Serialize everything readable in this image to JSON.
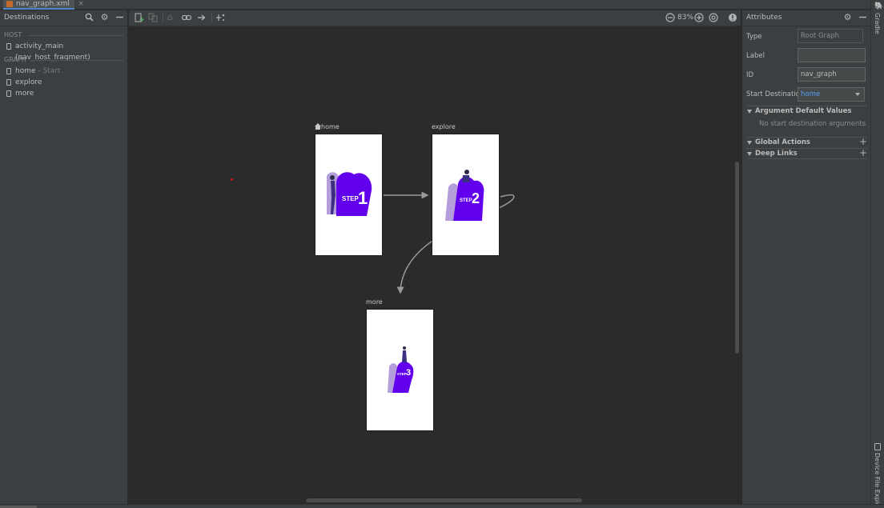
{
  "tab": {
    "filename": "nav_graph.xml",
    "close": "×"
  },
  "destinations": {
    "title": "Destinations",
    "host_label": "HOST",
    "host_item": "activity_main (nav_host_fragment)",
    "graph_label": "GRAPH",
    "items": [
      {
        "label": "home",
        "suffix": " - Start"
      },
      {
        "label": "explore",
        "suffix": ""
      },
      {
        "label": "more",
        "suffix": ""
      }
    ]
  },
  "toolbar": {
    "zoom": "83%"
  },
  "canvas": {
    "nodes": [
      {
        "label": "home",
        "step": "1",
        "step_word": "STEP"
      },
      {
        "label": "explore",
        "step": "2",
        "step_word": "STEP"
      },
      {
        "label": "more",
        "step": "3",
        "step_word": "STEP"
      }
    ]
  },
  "attributes": {
    "title": "Attributes",
    "type_label": "Type",
    "type_value": "Root Graph",
    "label_label": "Label",
    "label_value": "",
    "id_label": "ID",
    "id_value": "nav_graph",
    "start_label": "Start Destination",
    "start_value": "home",
    "arg_group": "Argument Default Values",
    "arg_empty": "No start destination arguments",
    "global_group": "Global Actions",
    "deep_group": "Deep Links"
  },
  "side_tools": {
    "top": "Gradle",
    "bottom": "Device File Explorer"
  },
  "colors": {
    "accent": "#4a88c7",
    "step_purple": "#6200ee",
    "step_light": "#b39ddb",
    "link": "#589df6"
  }
}
